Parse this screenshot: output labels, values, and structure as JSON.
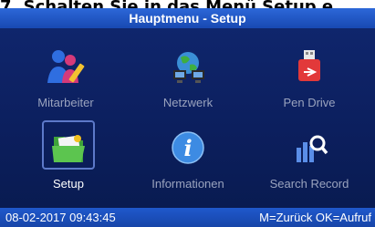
{
  "caption": "7. Schalten Sie in das Menü Setup e",
  "title": "Hauptmenu - Setup",
  "tiles": [
    {
      "label": "Mitarbeiter",
      "icon": "employees-icon"
    },
    {
      "label": "Netzwerk",
      "icon": "network-icon"
    },
    {
      "label": "Pen Drive",
      "icon": "usb-drive-icon"
    },
    {
      "label": "Setup",
      "icon": "folder-icon",
      "selected": true
    },
    {
      "label": "Informationen",
      "icon": "info-icon"
    },
    {
      "label": "Search Record",
      "icon": "search-record-icon"
    }
  ],
  "status": {
    "datetime": "08-02-2017  09:43:45",
    "hint": "M=Zurück OK=Aufruf"
  }
}
